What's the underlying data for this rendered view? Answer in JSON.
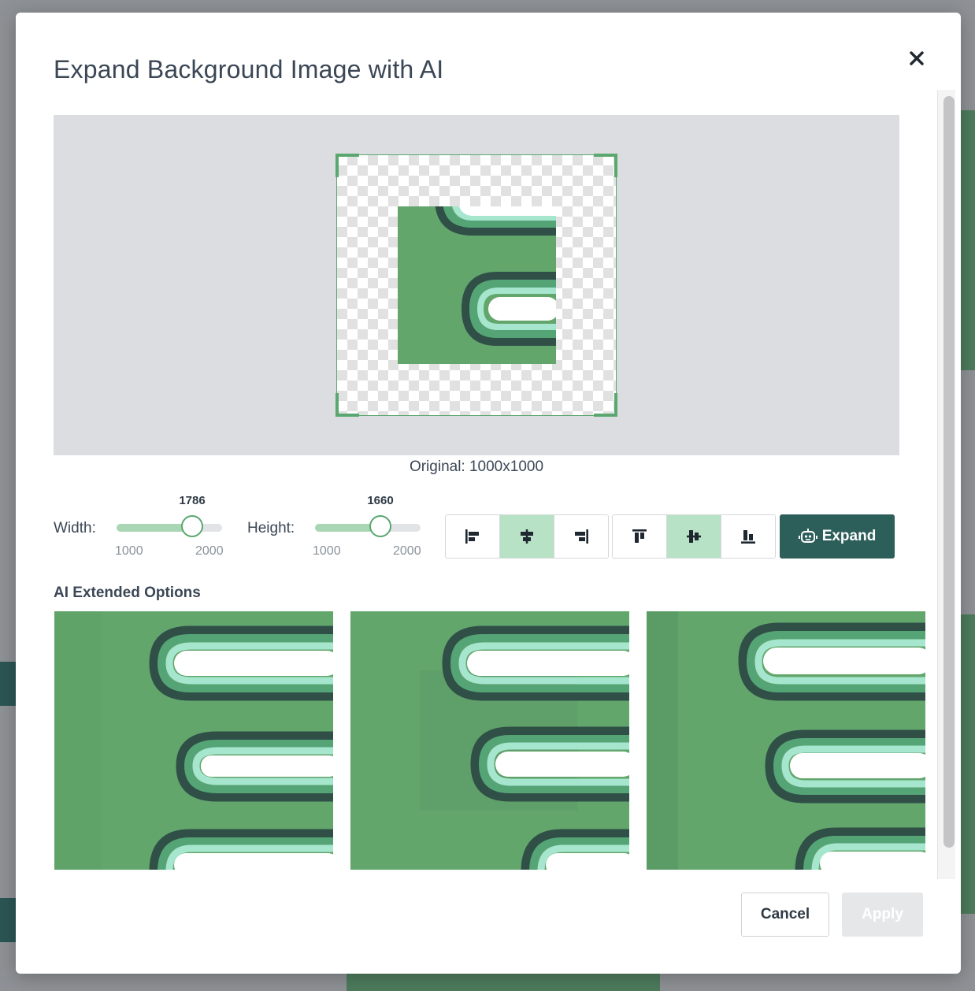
{
  "modal": {
    "title": "Expand Background Image with AI"
  },
  "preview": {
    "original_caption": "Original: 1000x1000"
  },
  "controls": {
    "width": {
      "label": "Width:",
      "value": "1786",
      "min": "1000",
      "max": "2000"
    },
    "height": {
      "label": "Height:",
      "value": "1660",
      "min": "1000",
      "max": "2000"
    },
    "horizontal_align": {
      "options": [
        "align-left-icon",
        "align-center-horizontal-icon",
        "align-right-icon"
      ],
      "selected": "align-center-horizontal-icon"
    },
    "vertical_align": {
      "options": [
        "align-top-icon",
        "align-middle-vertical-icon",
        "align-bottom-icon"
      ],
      "selected": "align-middle-vertical-icon"
    },
    "expand_label": "Expand"
  },
  "options": {
    "title": "AI Extended Options",
    "count": 3
  },
  "footer": {
    "cancel_label": "Cancel",
    "apply_label": "Apply"
  },
  "colors": {
    "brand_dark": "#2d5f5a",
    "accent_green": "#5aa770",
    "image_green": "#62a66c",
    "selected_segment": "#b8e2c5"
  }
}
